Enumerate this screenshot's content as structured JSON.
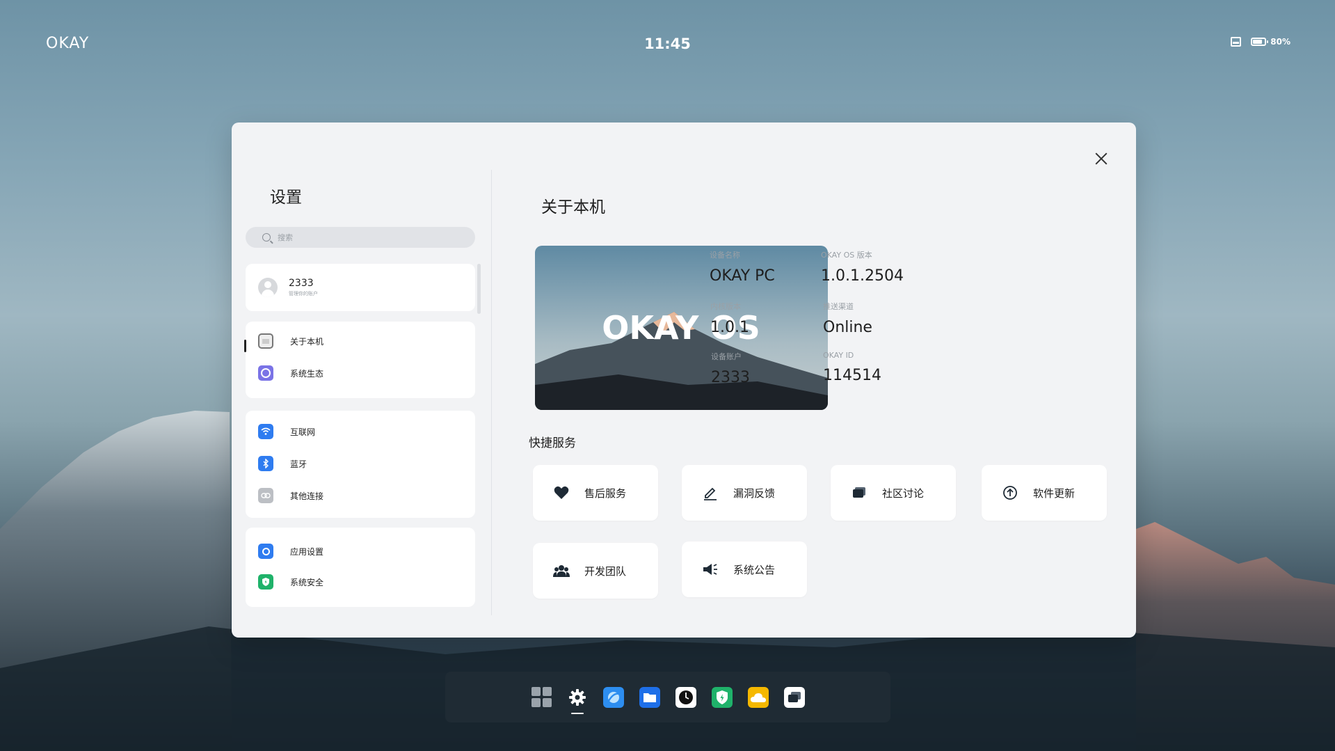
{
  "topbar": {
    "logo": "OKAY",
    "time": "11:45",
    "battery": "80%",
    "battery_level": 0.8
  },
  "sidebar": {
    "title": "设置",
    "search_placeholder": "搜索",
    "account": {
      "name": "2333",
      "subtitle": "管理你的账户"
    },
    "items": [
      {
        "label": "关于本机",
        "icon": "monitor-icon",
        "active": true
      },
      {
        "label": "系统生态",
        "icon": "ecosystem-icon"
      },
      {
        "label": "互联网",
        "icon": "wifi-icon"
      },
      {
        "label": "蓝牙",
        "icon": "bluetooth-icon"
      },
      {
        "label": "其他连接",
        "icon": "link-icon"
      },
      {
        "label": "应用设置",
        "icon": "app-settings-icon"
      },
      {
        "label": "系统安全",
        "icon": "shield-icon"
      }
    ]
  },
  "main": {
    "title": "关于本机",
    "hero_text": "OKAY OS",
    "info": [
      {
        "label": "设备名称",
        "value": "OKAY PC"
      },
      {
        "label": "OKAY OS 版本",
        "value": "1.0.1.2504"
      },
      {
        "label": "内核版本",
        "value": "1.0.1"
      },
      {
        "label": "推送渠道",
        "value": "Online"
      },
      {
        "label": "设备账户",
        "value": "2333"
      },
      {
        "label": "OKAY ID",
        "value": "114514"
      }
    ],
    "services_title": "快捷服务",
    "services": [
      {
        "label": "售后服务",
        "icon": "heart-icon"
      },
      {
        "label": "漏洞反馈",
        "icon": "edit-icon"
      },
      {
        "label": "社区讨论",
        "icon": "chat-icon"
      },
      {
        "label": "软件更新",
        "icon": "upload-icon"
      },
      {
        "label": "开发团队",
        "icon": "team-icon"
      },
      {
        "label": "系统公告",
        "icon": "megaphone-icon"
      }
    ]
  },
  "taskbar": {
    "apps": [
      "start-icon",
      "settings-icon",
      "browser-icon",
      "files-icon",
      "clock-icon",
      "security-icon",
      "weather-icon",
      "multitask-icon"
    ],
    "colors": {
      "settings": "#1f2b34",
      "browser": "#2d8ef0",
      "files": "#1e6fe8",
      "clock": "#ffffff",
      "security": "#1fb26a",
      "weather": "#f5b800",
      "multitask": "#ffffff"
    }
  }
}
